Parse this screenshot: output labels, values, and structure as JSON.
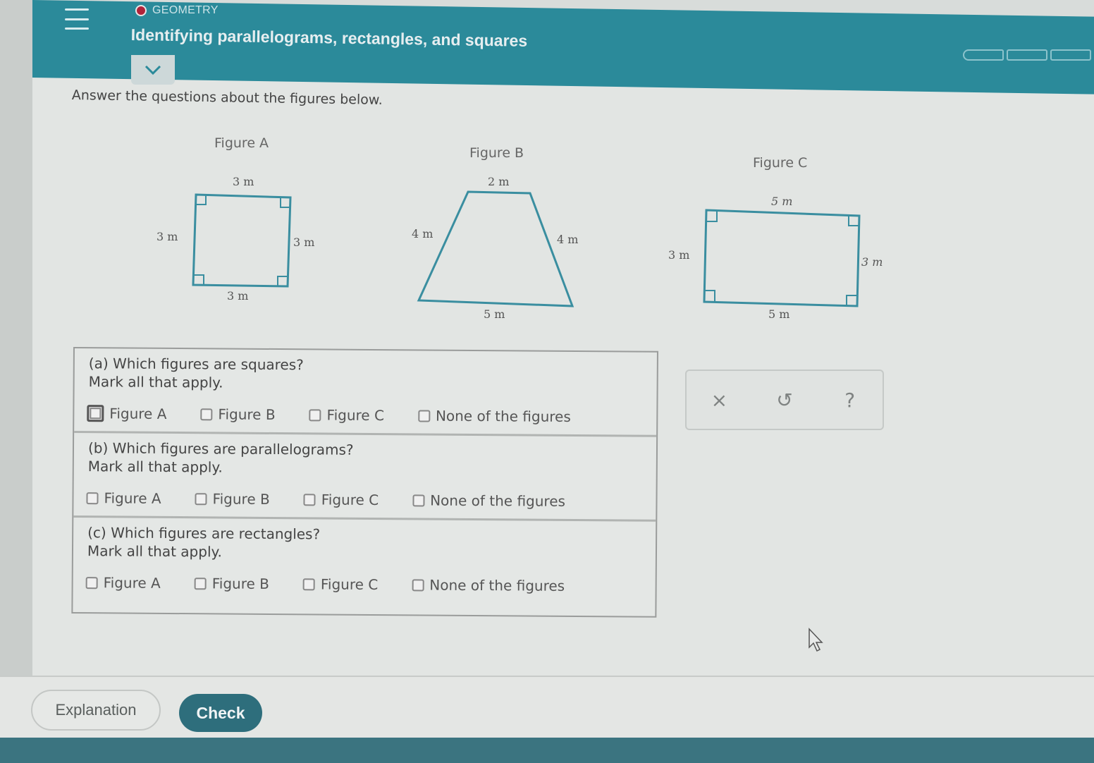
{
  "header": {
    "topic": "GEOMETRY",
    "title": "Identifying parallelograms, rectangles, and squares",
    "progress_segments": 3,
    "colors": {
      "header_bg": "#2b8a9a",
      "topic_dot": "#b0233a",
      "check_button": "#2e6e7c"
    }
  },
  "instruction": "Answer the questions about the figures below.",
  "figures": [
    {
      "label": "Figure A",
      "shape": "square",
      "sides": {
        "top": "3 m",
        "left": "3 m",
        "right": "3 m",
        "bottom": "3 m"
      },
      "right_angle_marks": 4
    },
    {
      "label": "Figure B",
      "shape": "trapezoid",
      "sides": {
        "top": "2 m",
        "left": "4 m",
        "right": "4 m",
        "bottom": "5 m"
      },
      "right_angle_marks": 0
    },
    {
      "label": "Figure C",
      "shape": "rectangle",
      "sides": {
        "top": "5 m",
        "left": "3 m",
        "right": "3 m",
        "bottom": "5 m"
      },
      "right_angle_marks": 4
    }
  ],
  "questions": [
    {
      "prompt": "(a) Which figures are squares?",
      "hint": "Mark all that apply.",
      "options": [
        {
          "label": "Figure A",
          "checked": false,
          "focused": true
        },
        {
          "label": "Figure B",
          "checked": false,
          "focused": false
        },
        {
          "label": "Figure C",
          "checked": false,
          "focused": false
        },
        {
          "label": "None of the figures",
          "checked": false,
          "focused": false
        }
      ]
    },
    {
      "prompt": "(b) Which figures are parallelograms?",
      "hint": "Mark all that apply.",
      "options": [
        {
          "label": "Figure A",
          "checked": false,
          "focused": false
        },
        {
          "label": "Figure B",
          "checked": false,
          "focused": false
        },
        {
          "label": "Figure C",
          "checked": false,
          "focused": false
        },
        {
          "label": "None of the figures",
          "checked": false,
          "focused": false
        }
      ]
    },
    {
      "prompt": "(c) Which figures are rectangles?",
      "hint": "Mark all that apply.",
      "options": [
        {
          "label": "Figure A",
          "checked": false,
          "focused": false
        },
        {
          "label": "Figure B",
          "checked": false,
          "focused": false
        },
        {
          "label": "Figure C",
          "checked": false,
          "focused": false
        },
        {
          "label": "None of the figures",
          "checked": false,
          "focused": false
        }
      ]
    }
  ],
  "tools": {
    "clear": "×",
    "undo": "↺",
    "help": "?"
  },
  "footer": {
    "explanation_label": "Explanation",
    "check_label": "Check"
  }
}
